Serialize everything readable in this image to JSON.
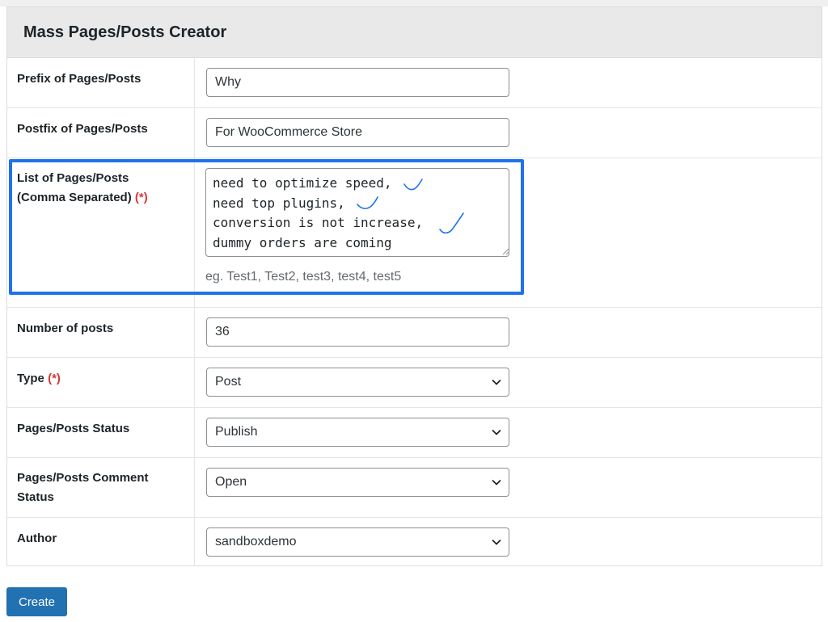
{
  "panel": {
    "title": "Mass Pages/Posts Creator"
  },
  "fields": {
    "prefix": {
      "label": "Prefix of Pages/Posts",
      "value": "Why"
    },
    "postfix": {
      "label": "Postfix of Pages/Posts",
      "value": "For WooCommerce Store"
    },
    "list": {
      "label_line1": "List of Pages/Posts",
      "label_line2": "(Comma Separated)",
      "required_mark": "(*)",
      "value": "need to optimize speed,\nneed top plugins,\nconversion is not increase,\ndummy orders are coming",
      "hint": "eg. Test1, Test2, test3, test4, test5"
    },
    "number": {
      "label": "Number of posts",
      "value": "36"
    },
    "type": {
      "label": "Type",
      "required_mark": "(*)",
      "value": "Post"
    },
    "status": {
      "label": "Pages/Posts Status",
      "value": "Publish"
    },
    "comment_status": {
      "label_line1": "Pages/Posts Comment",
      "label_line2": "Status",
      "value": "Open"
    },
    "author": {
      "label": "Author",
      "value": "sandboxdemo"
    }
  },
  "actions": {
    "create_label": "Create"
  },
  "colors": {
    "focus_outline": "#1e73e8",
    "primary_button": "#2271b1",
    "required": "#d63638"
  }
}
